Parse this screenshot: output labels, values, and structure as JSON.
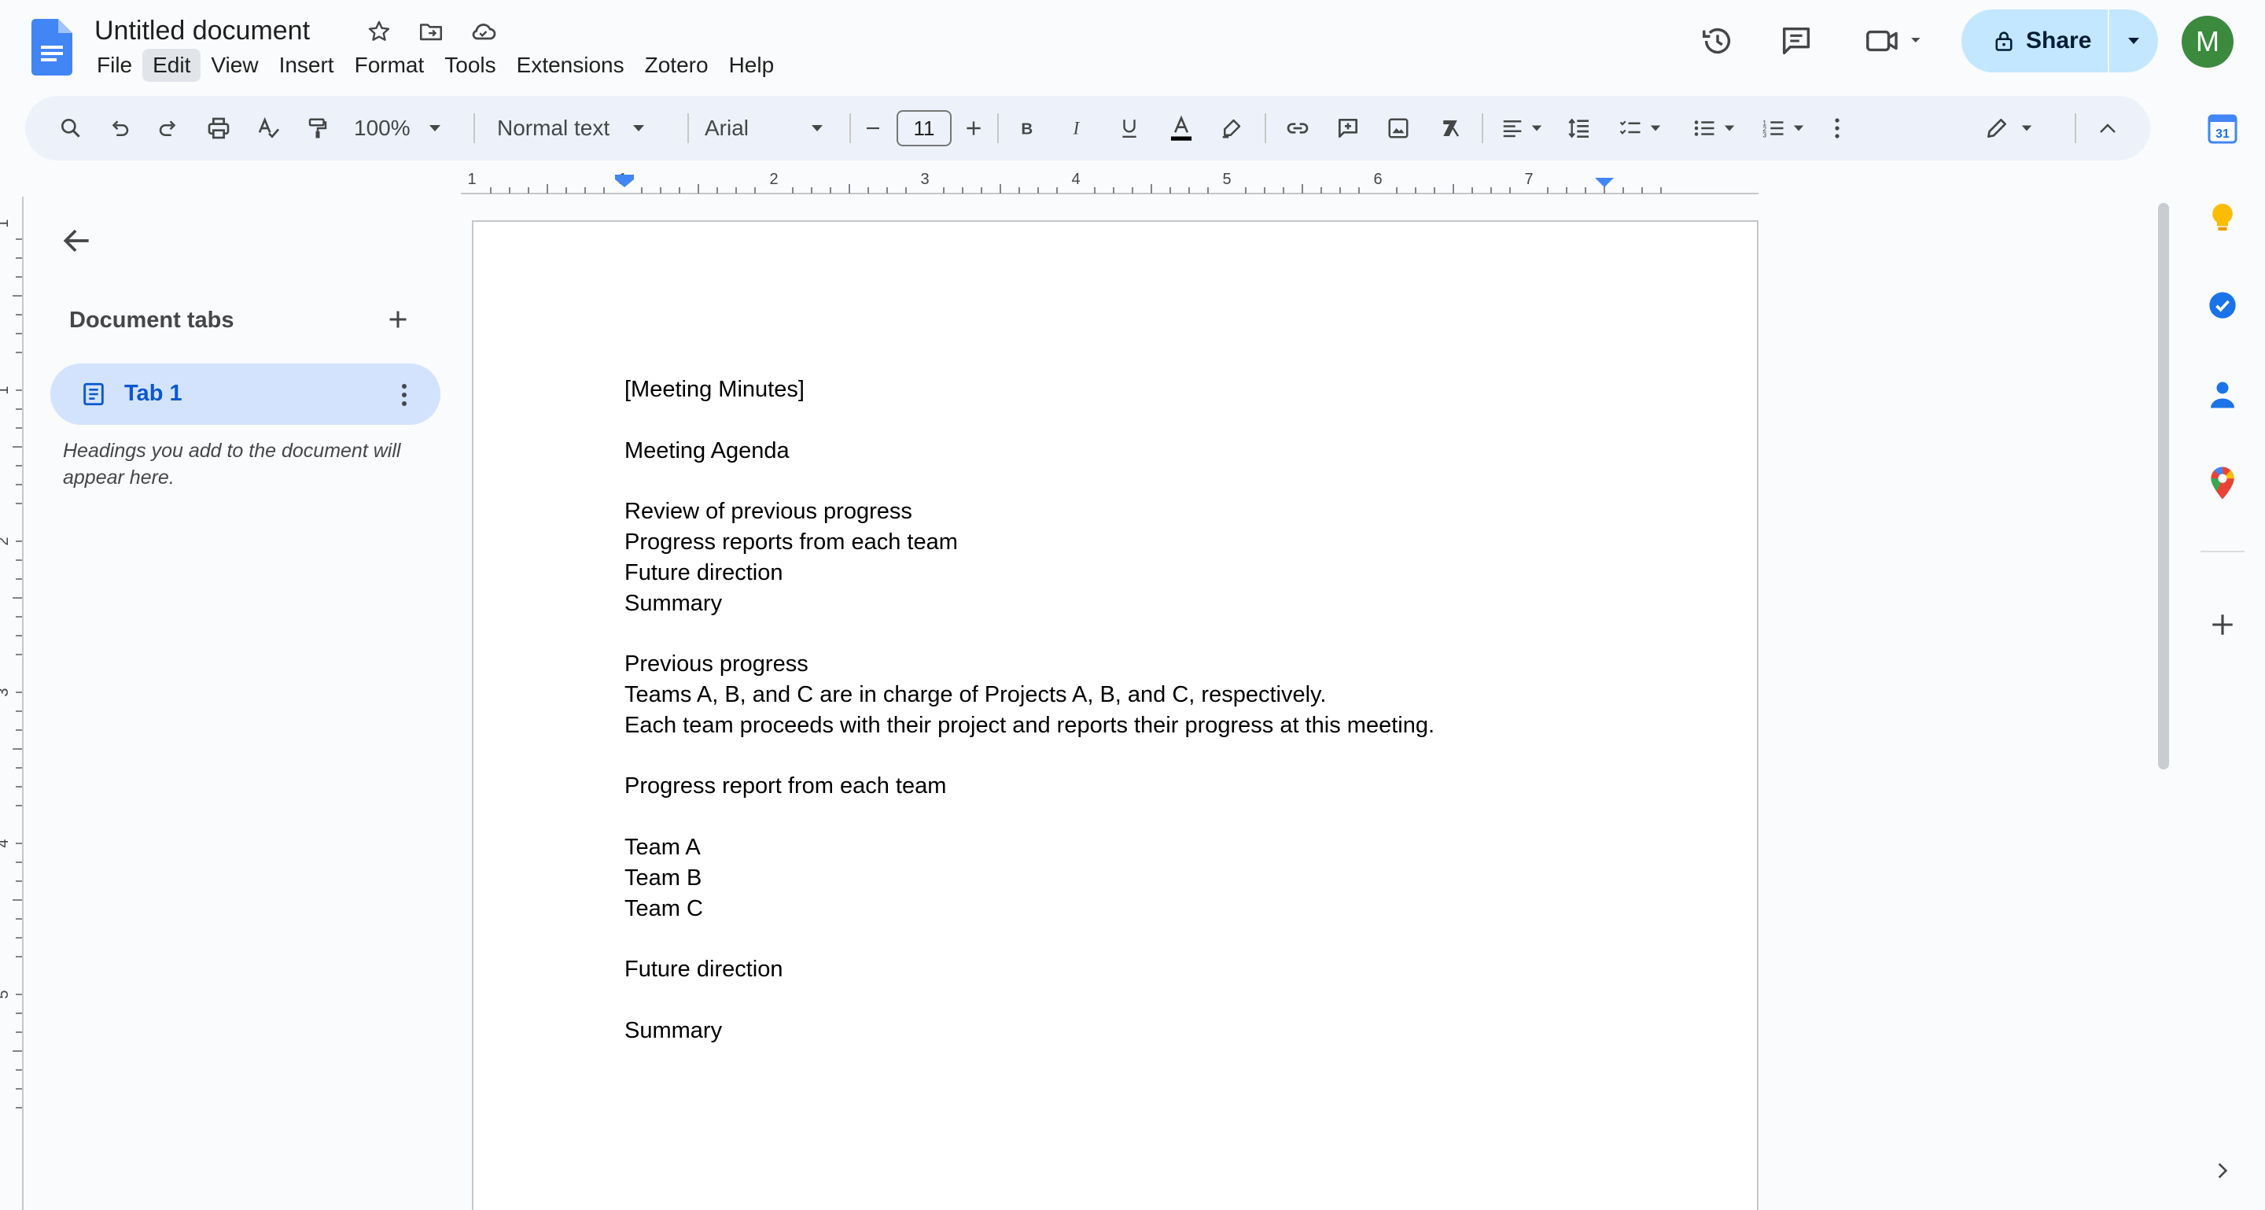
{
  "app": {
    "doc_title": "Untitled document"
  },
  "menu": [
    "File",
    "Edit",
    "View",
    "Insert",
    "Format",
    "Tools",
    "Extensions",
    "Zotero",
    "Help"
  ],
  "header_actions": {
    "share_label": "Share",
    "avatar_initial": "M"
  },
  "toolbar": {
    "zoom": "100%",
    "style": "Normal text",
    "font": "Arial",
    "font_size": "11"
  },
  "ruler": {
    "labels": [
      "1",
      "1",
      "2",
      "3",
      "4",
      "5",
      "6",
      "7"
    ]
  },
  "vertical_ruler": {
    "labels": [
      "1",
      "1",
      "2",
      "3",
      "4",
      "5"
    ]
  },
  "left_panel": {
    "title": "Document tabs",
    "tab_label": "Tab 1",
    "hint": "Headings you add to the document will appear here."
  },
  "document": {
    "lines": [
      "[Meeting Minutes]",
      "",
      "Meeting Agenda",
      "",
      "Review of previous progress",
      "Progress reports from each team",
      "Future direction",
      "Summary",
      "",
      "Previous progress",
      "Teams A, B, and C are in charge of Projects A, B, and C, respectively.",
      "Each team proceeds with their project and reports their progress at this meeting.",
      "",
      "Progress report from each team",
      "",
      "Team A",
      "Team B",
      "Team C",
      "",
      "Future direction",
      "",
      "Summary"
    ]
  },
  "side_panel": {
    "calendar_day": "31"
  },
  "colors": {
    "accent_blue": "#0b57d0",
    "share_bg": "#c2e7ff",
    "avatar_bg": "#3b8a3e",
    "toolbar_bg": "#edf2fa",
    "tab_selected_bg": "#d3e3fd"
  }
}
